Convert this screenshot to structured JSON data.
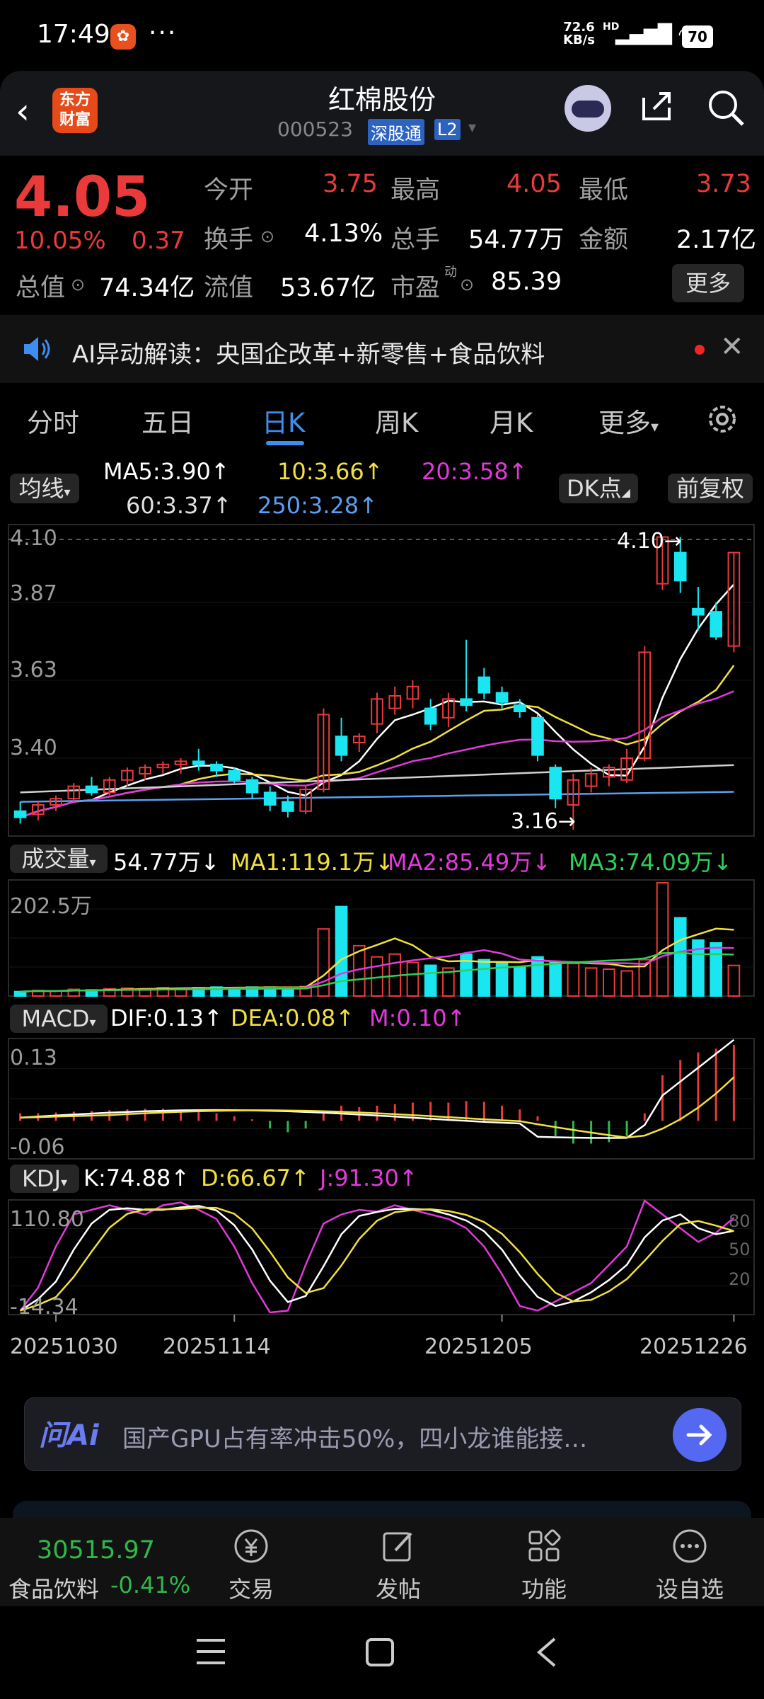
{
  "status": {
    "time": "17:49",
    "notif_icon": "app-notification",
    "dots": "···",
    "speed_value": "72.6",
    "speed_unit": "KB/s",
    "hd": "HD",
    "battery": "70"
  },
  "header": {
    "logo_top": "东方",
    "logo_bottom": "财富",
    "title": "红棉股份",
    "code": "000523",
    "tag_exchange": "深股通",
    "tag_level": "L2"
  },
  "quote": {
    "price": "4.05",
    "pct": "10.05%",
    "chg": "0.37",
    "open_label": "今开",
    "open": "3.75",
    "high_label": "最高",
    "high": "4.05",
    "low_label": "最低",
    "low": "3.73",
    "turnover_label": "换手",
    "turnover": "4.13%",
    "volume_label": "总手",
    "volume": "54.77万",
    "amount_label": "金额",
    "amount": "2.17亿",
    "mcap_label": "总值",
    "mcap": "74.34亿",
    "float_label": "流值",
    "float": "53.67亿",
    "pe_label": "市盈",
    "pe_sup": "动",
    "pe": "85.39",
    "more": "更多"
  },
  "ai_banner": {
    "text": "AI异动解读：央国企改革+新零售+食品饮料"
  },
  "tabs": [
    {
      "label": "分时"
    },
    {
      "label": "五日"
    },
    {
      "label": "日K"
    },
    {
      "label": "周K"
    },
    {
      "label": "月K"
    },
    {
      "label": "更多"
    }
  ],
  "ma_row": {
    "selector": "均线",
    "ma5": "MA5:3.90↑",
    "ma10": "10:3.66↑",
    "ma20": "20:3.58↑",
    "ma60": "60:3.37↑",
    "ma250": "250:3.28↑",
    "dk": "DK点",
    "fq": "前复权"
  },
  "kline": {
    "y_labels": [
      "4.10",
      "3.87",
      "3.63",
      "3.40"
    ],
    "max_label": "4.10",
    "min_label": "3.16"
  },
  "volume_panel": {
    "selector": "成交量",
    "vol": "54.77万↓",
    "ma1": "MA1:119.1万↓",
    "ma2": "MA2:85.49万↓",
    "ma3": "MA3:74.09万↓",
    "y_label": "202.5万"
  },
  "macd_panel": {
    "selector": "MACD",
    "dif": "DIF:0.13↑",
    "dea": "DEA:0.08↑",
    "m": "M:0.10↑",
    "y_top": "0.13",
    "y_bottom": "-0.06"
  },
  "kdj_panel": {
    "selector": "KDJ",
    "k": "K:74.88↑",
    "d": "D:66.67↑",
    "j": "J:91.30↑",
    "y_top": "110.80",
    "y_bottom": "-14.34",
    "r80": "80",
    "r50": "50",
    "r20": "20"
  },
  "dates": [
    "20251030",
    "20251114",
    "20251205",
    "20251226"
  ],
  "chart_data": {
    "type": "candlestick",
    "candles": [
      {
        "o": 3.22,
        "h": 3.25,
        "l": 3.18,
        "c": 3.2
      },
      {
        "o": 3.21,
        "h": 3.25,
        "l": 3.19,
        "c": 3.24
      },
      {
        "o": 3.24,
        "h": 3.27,
        "l": 3.22,
        "c": 3.26
      },
      {
        "o": 3.26,
        "h": 3.31,
        "l": 3.25,
        "c": 3.3
      },
      {
        "o": 3.3,
        "h": 3.33,
        "l": 3.27,
        "c": 3.28
      },
      {
        "o": 3.28,
        "h": 3.33,
        "l": 3.27,
        "c": 3.32
      },
      {
        "o": 3.32,
        "h": 3.36,
        "l": 3.3,
        "c": 3.35
      },
      {
        "o": 3.34,
        "h": 3.37,
        "l": 3.32,
        "c": 3.36
      },
      {
        "o": 3.36,
        "h": 3.38,
        "l": 3.34,
        "c": 3.37
      },
      {
        "o": 3.37,
        "h": 3.39,
        "l": 3.34,
        "c": 3.38
      },
      {
        "o": 3.38,
        "h": 3.42,
        "l": 3.35,
        "c": 3.37
      },
      {
        "o": 3.37,
        "h": 3.38,
        "l": 3.33,
        "c": 3.35
      },
      {
        "o": 3.35,
        "h": 3.36,
        "l": 3.31,
        "c": 3.32
      },
      {
        "o": 3.32,
        "h": 3.33,
        "l": 3.26,
        "c": 3.28
      },
      {
        "o": 3.28,
        "h": 3.3,
        "l": 3.22,
        "c": 3.24
      },
      {
        "o": 3.25,
        "h": 3.27,
        "l": 3.2,
        "c": 3.22
      },
      {
        "o": 3.22,
        "h": 3.3,
        "l": 3.21,
        "c": 3.29
      },
      {
        "o": 3.29,
        "h": 3.55,
        "l": 3.28,
        "c": 3.53
      },
      {
        "o": 3.46,
        "h": 3.52,
        "l": 3.38,
        "c": 3.4
      },
      {
        "o": 3.44,
        "h": 3.47,
        "l": 3.41,
        "c": 3.46
      },
      {
        "o": 3.5,
        "h": 3.6,
        "l": 3.47,
        "c": 3.58
      },
      {
        "o": 3.55,
        "h": 3.62,
        "l": 3.53,
        "c": 3.59
      },
      {
        "o": 3.58,
        "h": 3.64,
        "l": 3.55,
        "c": 3.62
      },
      {
        "o": 3.55,
        "h": 3.58,
        "l": 3.48,
        "c": 3.5
      },
      {
        "o": 3.52,
        "h": 3.6,
        "l": 3.49,
        "c": 3.58
      },
      {
        "o": 3.58,
        "h": 3.77,
        "l": 3.54,
        "c": 3.56
      },
      {
        "o": 3.65,
        "h": 3.68,
        "l": 3.58,
        "c": 3.6
      },
      {
        "o": 3.6,
        "h": 3.62,
        "l": 3.55,
        "c": 3.57
      },
      {
        "o": 3.56,
        "h": 3.58,
        "l": 3.52,
        "c": 3.54
      },
      {
        "o": 3.52,
        "h": 3.53,
        "l": 3.38,
        "c": 3.4
      },
      {
        "o": 3.36,
        "h": 3.37,
        "l": 3.23,
        "c": 3.26
      },
      {
        "o": 3.24,
        "h": 3.34,
        "l": 3.16,
        "c": 3.32
      },
      {
        "o": 3.3,
        "h": 3.36,
        "l": 3.28,
        "c": 3.34
      },
      {
        "o": 3.33,
        "h": 3.37,
        "l": 3.3,
        "c": 3.36
      },
      {
        "o": 3.32,
        "h": 3.42,
        "l": 3.31,
        "c": 3.39
      },
      {
        "o": 3.39,
        "h": 3.75,
        "l": 3.38,
        "c": 3.73
      },
      {
        "o": 3.95,
        "h": 4.1,
        "l": 3.93,
        "c": 4.1
      },
      {
        "o": 4.05,
        "h": 4.1,
        "l": 3.92,
        "c": 3.96
      },
      {
        "o": 3.87,
        "h": 3.94,
        "l": 3.8,
        "c": 3.85
      },
      {
        "o": 3.86,
        "h": 3.89,
        "l": 3.77,
        "c": 3.78
      },
      {
        "o": 3.75,
        "h": 4.05,
        "l": 3.73,
        "c": 4.05
      }
    ],
    "volume_wan": [
      8,
      10,
      9,
      12,
      11,
      13,
      14,
      13,
      15,
      14,
      15,
      16,
      15,
      16,
      16,
      14,
      17,
      120,
      160,
      90,
      70,
      75,
      60,
      55,
      50,
      75,
      65,
      60,
      52,
      70,
      62,
      58,
      50,
      48,
      45,
      65,
      202.5,
      140,
      100,
      95,
      54.77
    ],
    "macd_m": [
      0.01,
      0.01,
      0.011,
      0.012,
      0.013,
      0.014,
      0.015,
      0.016,
      0.016,
      0.015,
      0.013,
      0.01,
      0.006,
      0.002,
      -0.01,
      -0.015,
      -0.01,
      0.01,
      0.02,
      0.018,
      0.02,
      0.022,
      0.024,
      0.025,
      0.024,
      0.026,
      0.025,
      0.02,
      0.015,
      0.006,
      -0.02,
      -0.03,
      -0.03,
      -0.028,
      -0.02,
      0.01,
      0.06,
      0.08,
      0.09,
      0.095,
      0.1
    ],
    "kdj_j": [
      -10,
      15,
      60,
      95,
      100,
      105,
      100,
      95,
      105,
      108,
      100,
      90,
      60,
      20,
      -12,
      -10,
      40,
      85,
      95,
      100,
      98,
      105,
      100,
      95,
      90,
      80,
      60,
      30,
      -5,
      -10,
      0,
      10,
      20,
      40,
      60,
      110,
      95,
      80,
      65,
      75,
      91.3
    ]
  }
}
